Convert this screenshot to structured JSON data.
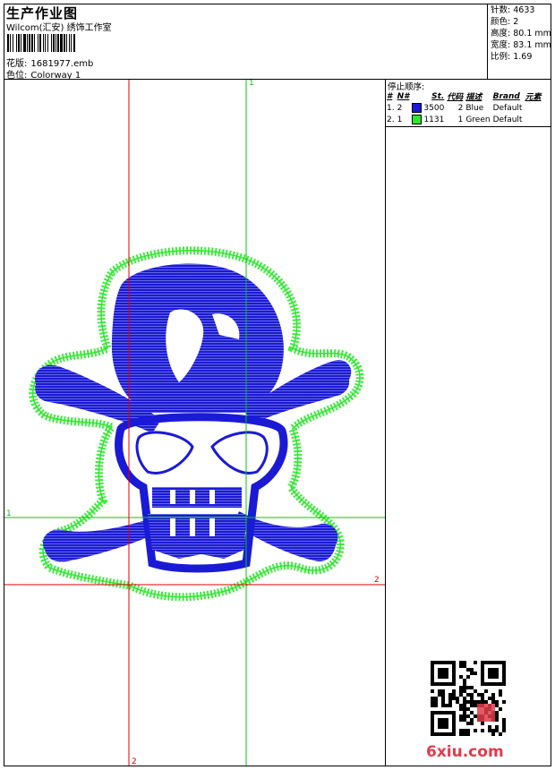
{
  "header": {
    "title": "生产作业图",
    "studio": "Wilcom(汇安) 绣饰工作室",
    "design_label": "花版:",
    "design_value": "1681977.emb",
    "colorway_label": "色位:",
    "colorway_value": "Colorway 1"
  },
  "stats": {
    "stitches_label": "针数:",
    "stitches": "4633",
    "colors_label": "颜色:",
    "colors": "2",
    "height_label": "高度:",
    "height": "80.1 mm",
    "width_label": "宽度:",
    "width": "83.1 mm",
    "scale_label": "比例:",
    "scale": "1.69"
  },
  "stop_sequence": {
    "title": "停止顺序:",
    "columns": [
      "#",
      "N#",
      "St.",
      "代码",
      "描述",
      "Brand",
      "元素"
    ],
    "rows": [
      {
        "idx": "1.",
        "n": "2",
        "color": "#1a1ad6",
        "st": "3500",
        "code": "2",
        "desc": "Blue",
        "brand": "Default"
      },
      {
        "idx": "2.",
        "n": "1",
        "color": "#2ee82e",
        "st": "1131",
        "code": "1",
        "desc": "Green",
        "brand": "Default"
      }
    ]
  },
  "guides": {
    "label_1": "1",
    "label_2": "2",
    "color_1": "#00cc00",
    "color_2": "#dd0000"
  },
  "colors": {
    "blue_thread": "#1a1ad6",
    "green_thread": "#2ee82e"
  },
  "footer": {
    "site": "6xiu.com"
  }
}
